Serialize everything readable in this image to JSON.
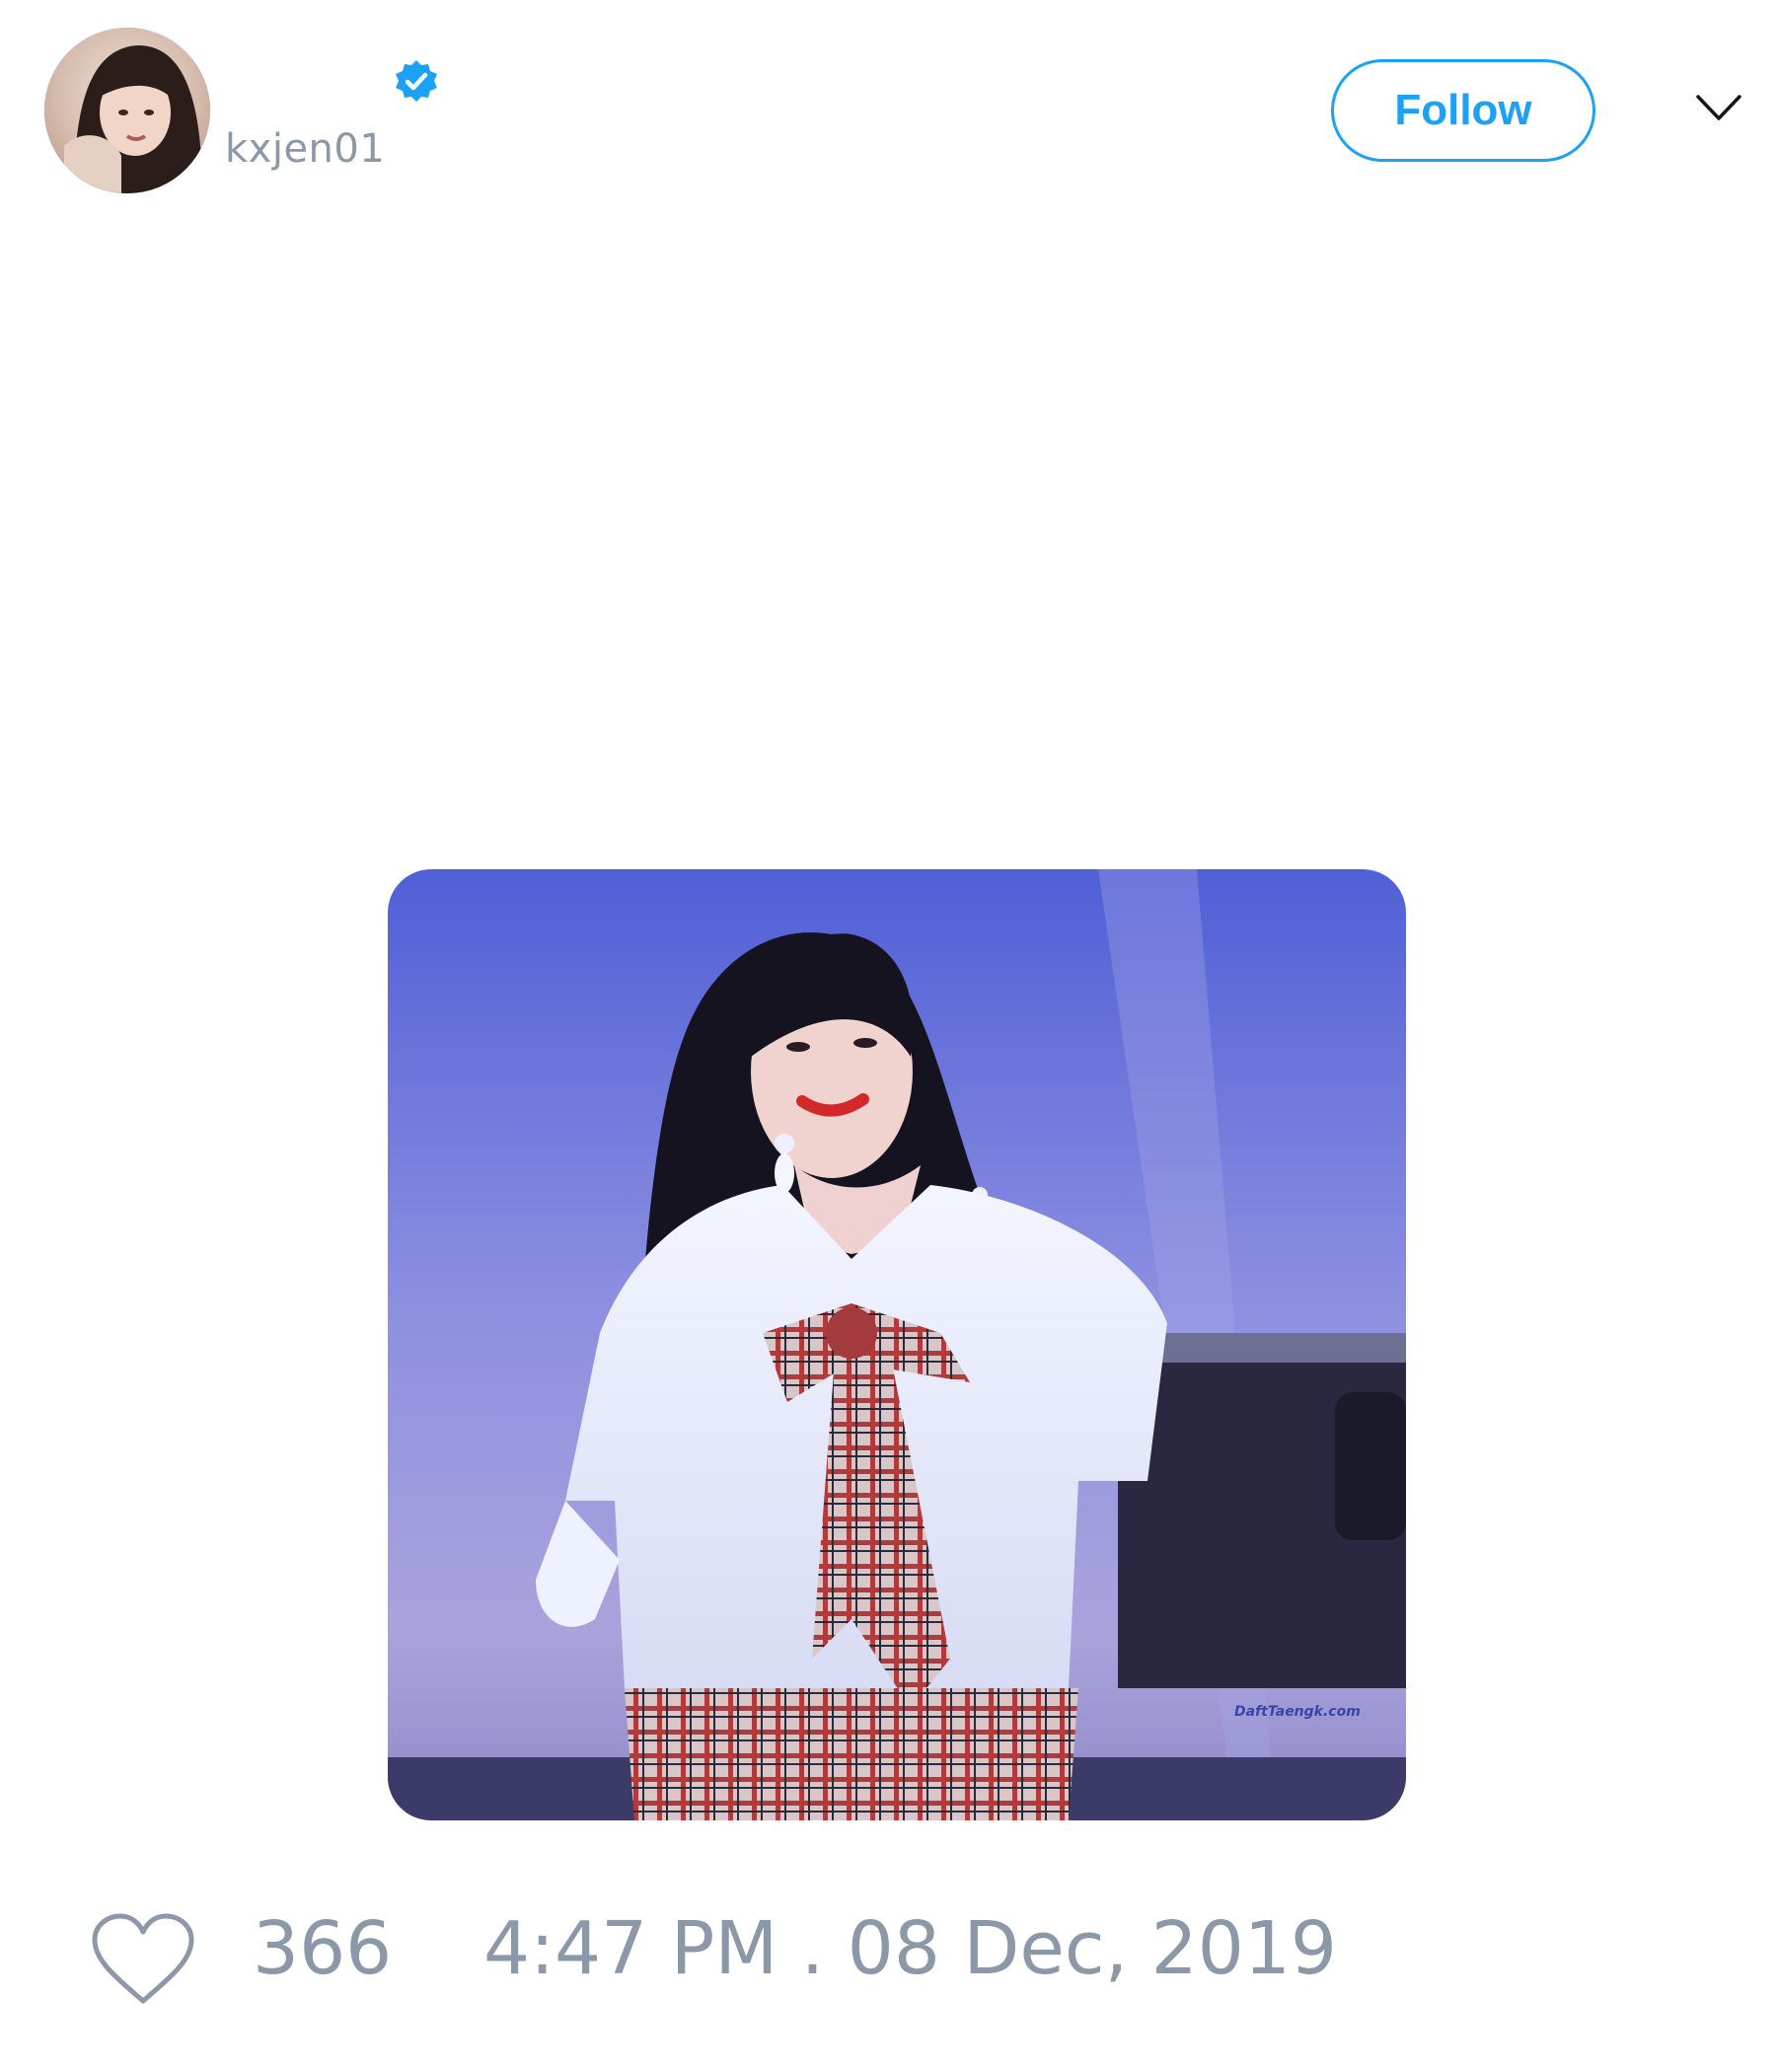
{
  "tweet": {
    "author": {
      "display_name": "",
      "handle": "kxjen01",
      "verified": true,
      "avatar_icon": "profile-photo"
    },
    "actions": {
      "follow_label": "Follow",
      "menu_icon": "chevron-down-icon"
    },
    "media": {
      "type": "image",
      "watermark": "DaftTaengk.com"
    },
    "footer": {
      "like_icon": "heart-outline-icon",
      "like_count": "366",
      "timestamp": "4:47 PM . 08 Dec, 2019"
    }
  },
  "colors": {
    "accent": "#1da1f2",
    "muted_text": "#8b98a8",
    "background": "#ffffff"
  }
}
